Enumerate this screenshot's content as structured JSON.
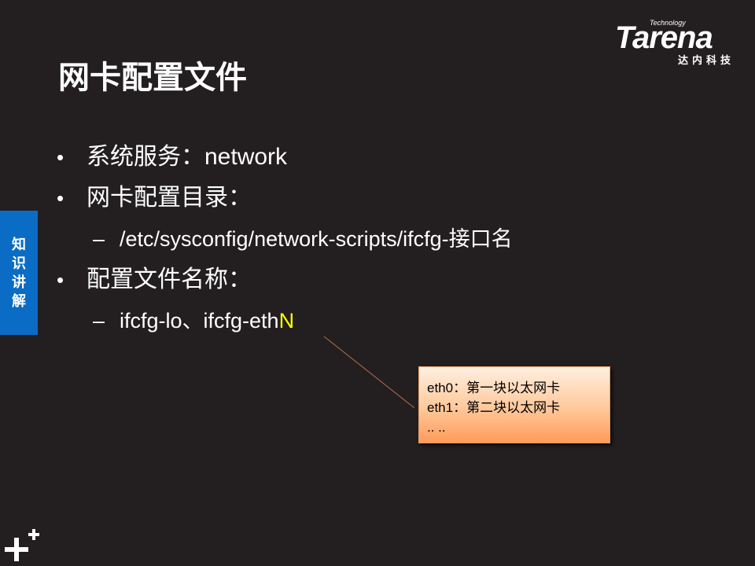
{
  "logo": {
    "tech": "Technology",
    "word": "Tarena",
    "cn": "达内科技"
  },
  "title": "网卡配置文件",
  "side_tab": [
    "知",
    "识",
    "讲",
    "解"
  ],
  "bullets": {
    "b1": "系统服务：network",
    "b2": "网卡配置目录：",
    "b2_sub": "/etc/sysconfig/network-scripts/ifcfg-接口名",
    "b3": "配置文件名称：",
    "b3_sub_prefix": "ifcfg-lo、ifcfg-eth",
    "b3_sub_highlight": "N",
    "dash": "–"
  },
  "callout": {
    "lines": [
      "eth0：第一块以太网卡",
      "eth1：第二块以太网卡",
      ".. .."
    ]
  },
  "colors": {
    "background": "#231f20",
    "side_tab": "#0a6cc4",
    "highlight": "#ffff00",
    "callout_line": "#b5714a"
  },
  "icons": {
    "corner": "plus-icon"
  }
}
